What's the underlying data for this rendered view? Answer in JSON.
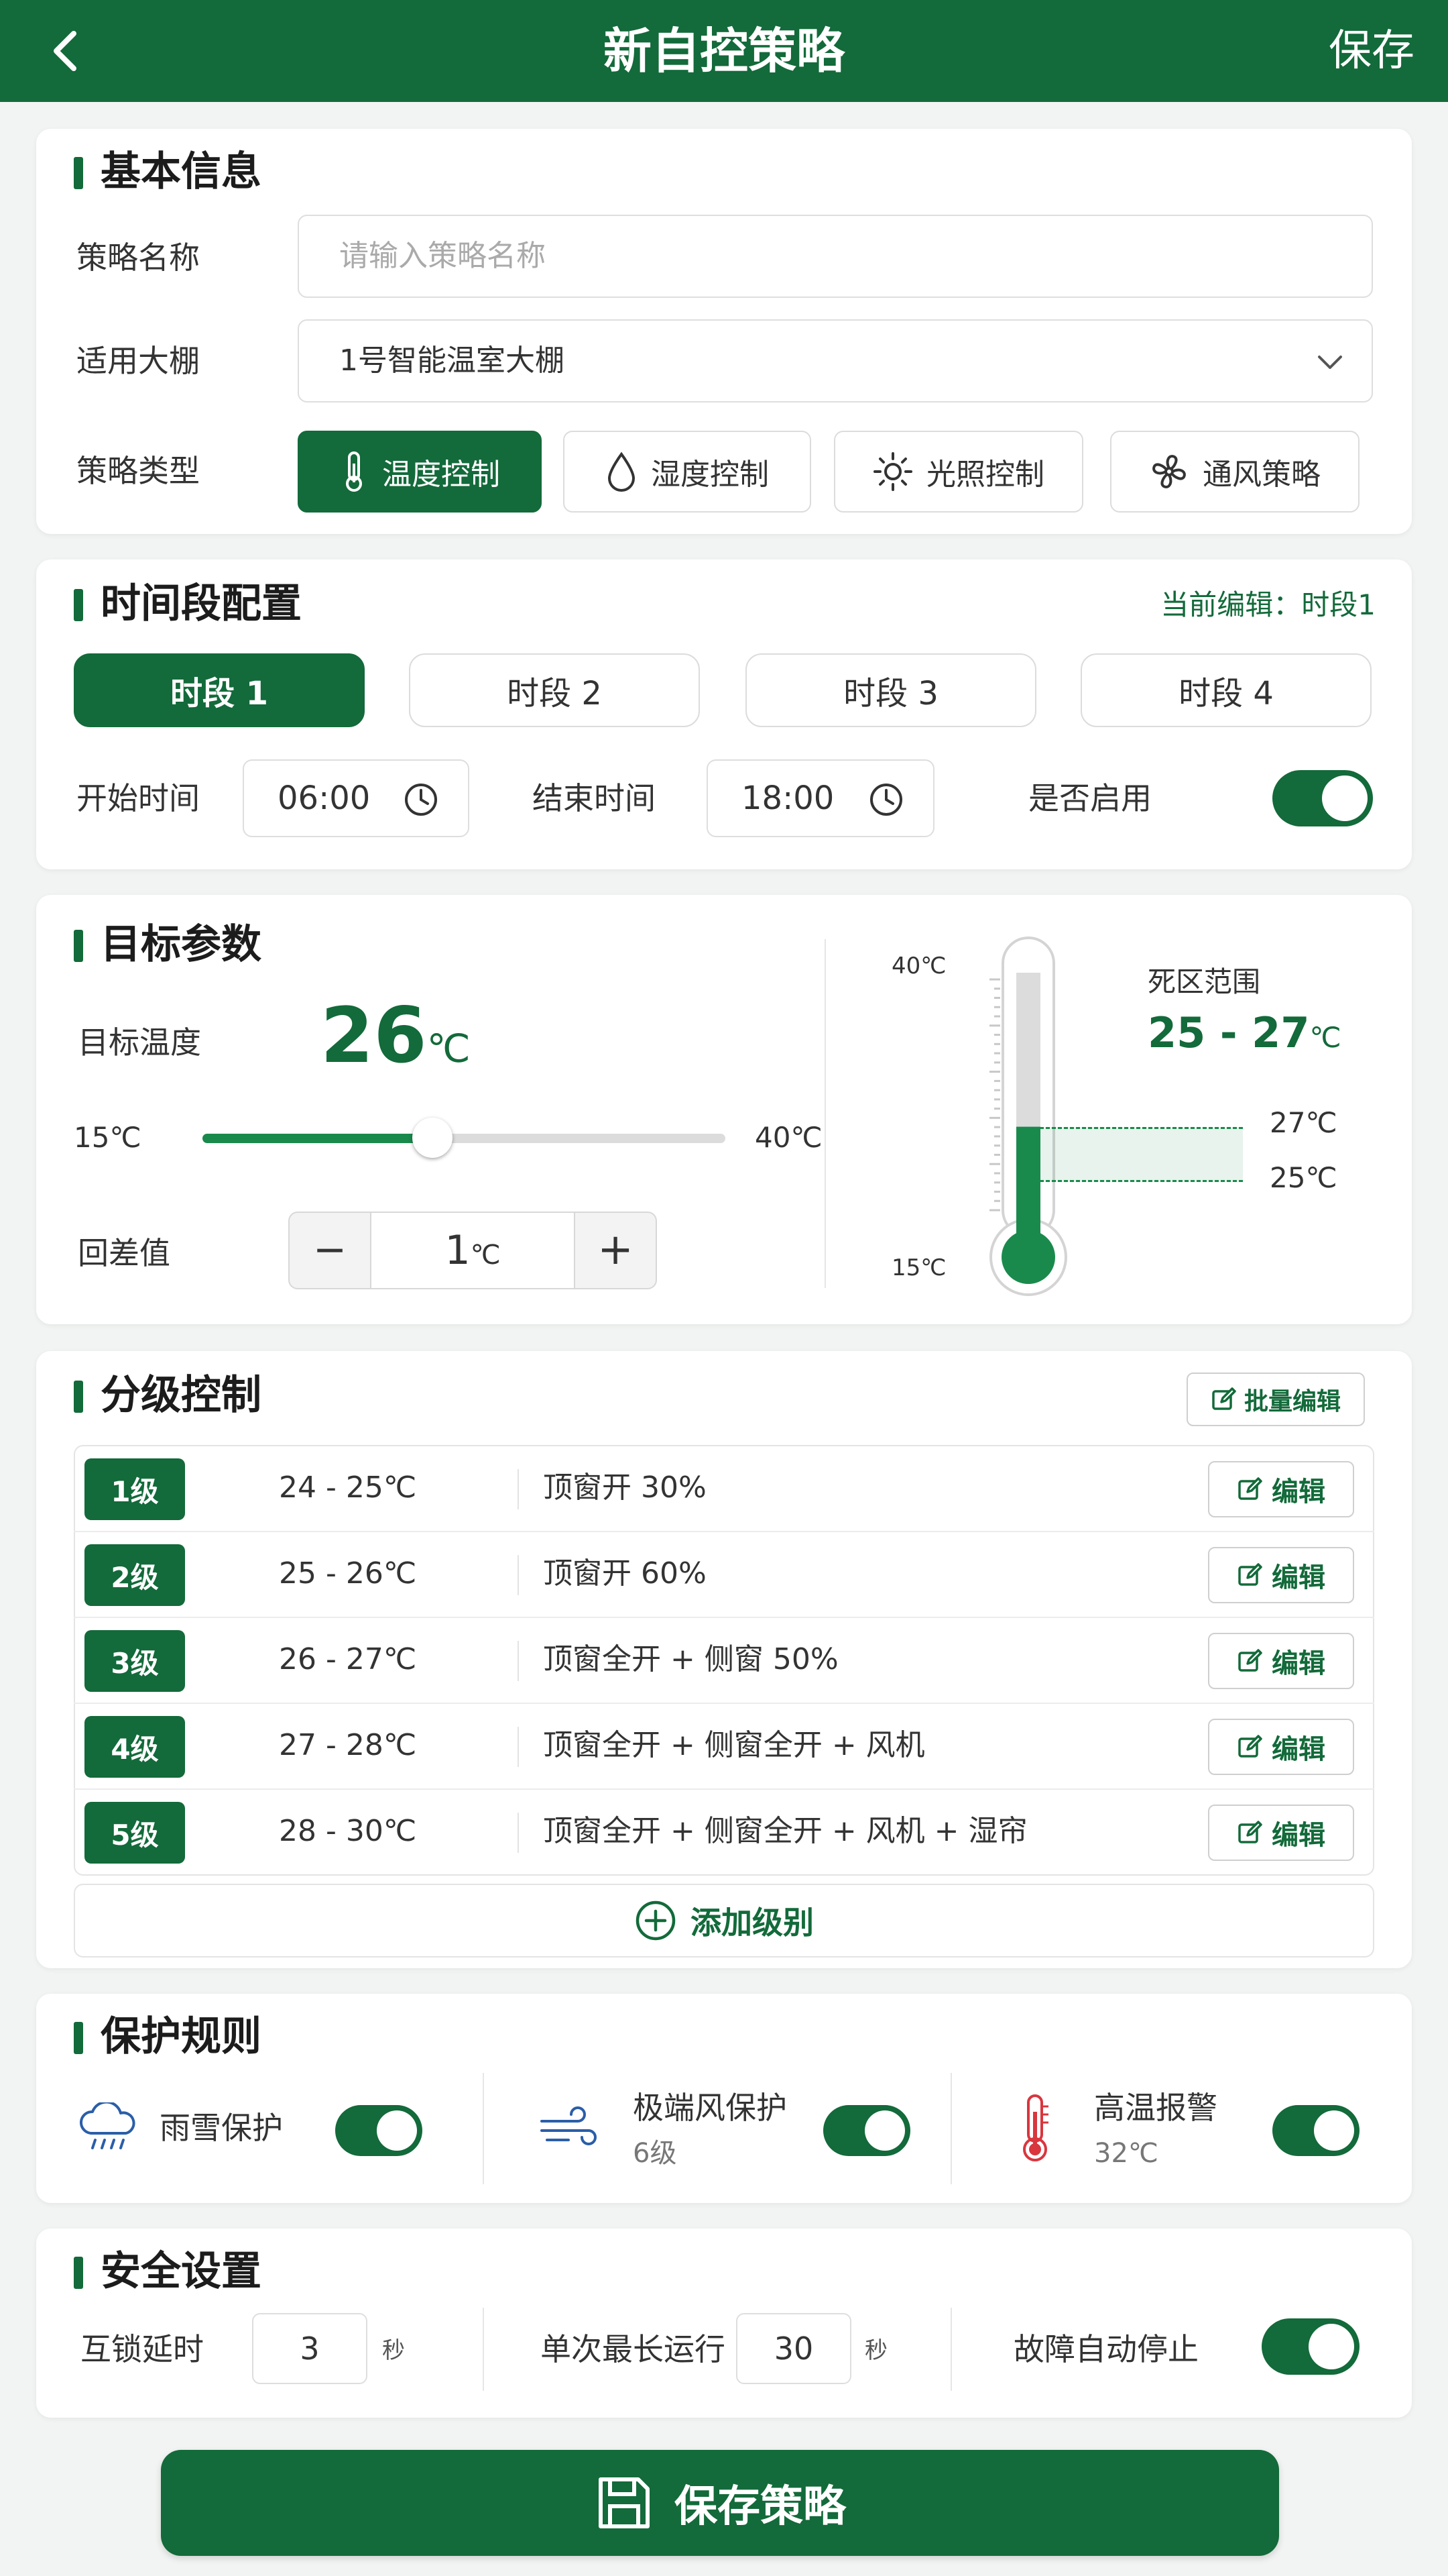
{
  "header": {
    "title": "新自控策略",
    "save_label": "保存"
  },
  "basic": {
    "title": "基本信息",
    "name_label": "策略名称",
    "name_placeholder": "请输入策略名称",
    "greenhouse_label": "适用大棚",
    "greenhouse_value": "1号智能温室大棚",
    "type_label": "策略类型",
    "types": [
      {
        "label": "温度控制",
        "icon": "thermometer-icon",
        "active": true
      },
      {
        "label": "湿度控制",
        "icon": "droplet-icon",
        "active": false
      },
      {
        "label": "光照控制",
        "icon": "sun-icon",
        "active": false
      },
      {
        "label": "通风策略",
        "icon": "fan-icon",
        "active": false
      }
    ]
  },
  "periods": {
    "title": "时间段配置",
    "current_prefix": "当前编辑：",
    "current_value": "时段1",
    "tabs": [
      "时段 1",
      "时段 2",
      "时段 3",
      "时段 4"
    ],
    "active_index": 0,
    "start_label": "开始时间",
    "start_value": "06:00",
    "end_label": "结束时间",
    "end_value": "18:00",
    "enabled_label": "是否启用",
    "enabled": true
  },
  "target": {
    "title": "目标参数",
    "temp_label": "目标温度",
    "temp_value": "26",
    "temp_unit": "℃",
    "slider_min": "15℃",
    "slider_max": "40℃",
    "slider_fraction": 0.44,
    "hysteresis_label": "回差值",
    "hysteresis_value": "1",
    "hysteresis_unit": "℃",
    "minus": "−",
    "plus": "+",
    "thermo_top": "40℃",
    "thermo_bottom": "15℃",
    "deadband_label": "死区范围",
    "deadband_value": "25 - 27",
    "deadband_unit": "℃",
    "deadband_high": "27℃",
    "deadband_low": "25℃",
    "thermo_fill_value": 26,
    "thermo_range": [
      15,
      40
    ]
  },
  "levels": {
    "title": "分级控制",
    "batch_edit": "批量编辑",
    "edit_label": "编辑",
    "add_label": "添加级别",
    "rows": [
      {
        "tag": "1级",
        "range": "24 - 25℃",
        "action": "顶窗开 30%"
      },
      {
        "tag": "2级",
        "range": "25 - 26℃",
        "action": "顶窗开 60%"
      },
      {
        "tag": "3级",
        "range": "26 - 27℃",
        "action": "顶窗全开 + 侧窗 50%"
      },
      {
        "tag": "4级",
        "range": "27 - 28℃",
        "action": "顶窗全开 + 侧窗全开 + 风机"
      },
      {
        "tag": "5级",
        "range": "28 - 30℃",
        "action": "顶窗全开 + 侧窗全开 + 风机 + 湿帘"
      }
    ]
  },
  "protect": {
    "title": "保护规则",
    "items": [
      {
        "label": "雨雪保护",
        "sub": "",
        "icon": "rain-cloud-icon",
        "enabled": true
      },
      {
        "label": "极端风保护",
        "sub": "6级",
        "icon": "wind-icon",
        "enabled": true
      },
      {
        "label": "高温报警",
        "sub": "32℃",
        "icon": "thermometer-alert-icon",
        "enabled": true
      }
    ]
  },
  "safety": {
    "title": "安全设置",
    "interlock_label": "互锁延时",
    "interlock_value": "3",
    "interlock_unit": "秒",
    "maxrun_label": "单次最长运行",
    "maxrun_value": "30",
    "maxrun_unit": "秒",
    "fault_label": "故障自动停止",
    "fault_enabled": true
  },
  "footer": {
    "save_policy": "保存策略"
  },
  "colors": {
    "primary": "#136a3a",
    "accent": "#1a8a4c",
    "alarm": "#d9363e"
  }
}
